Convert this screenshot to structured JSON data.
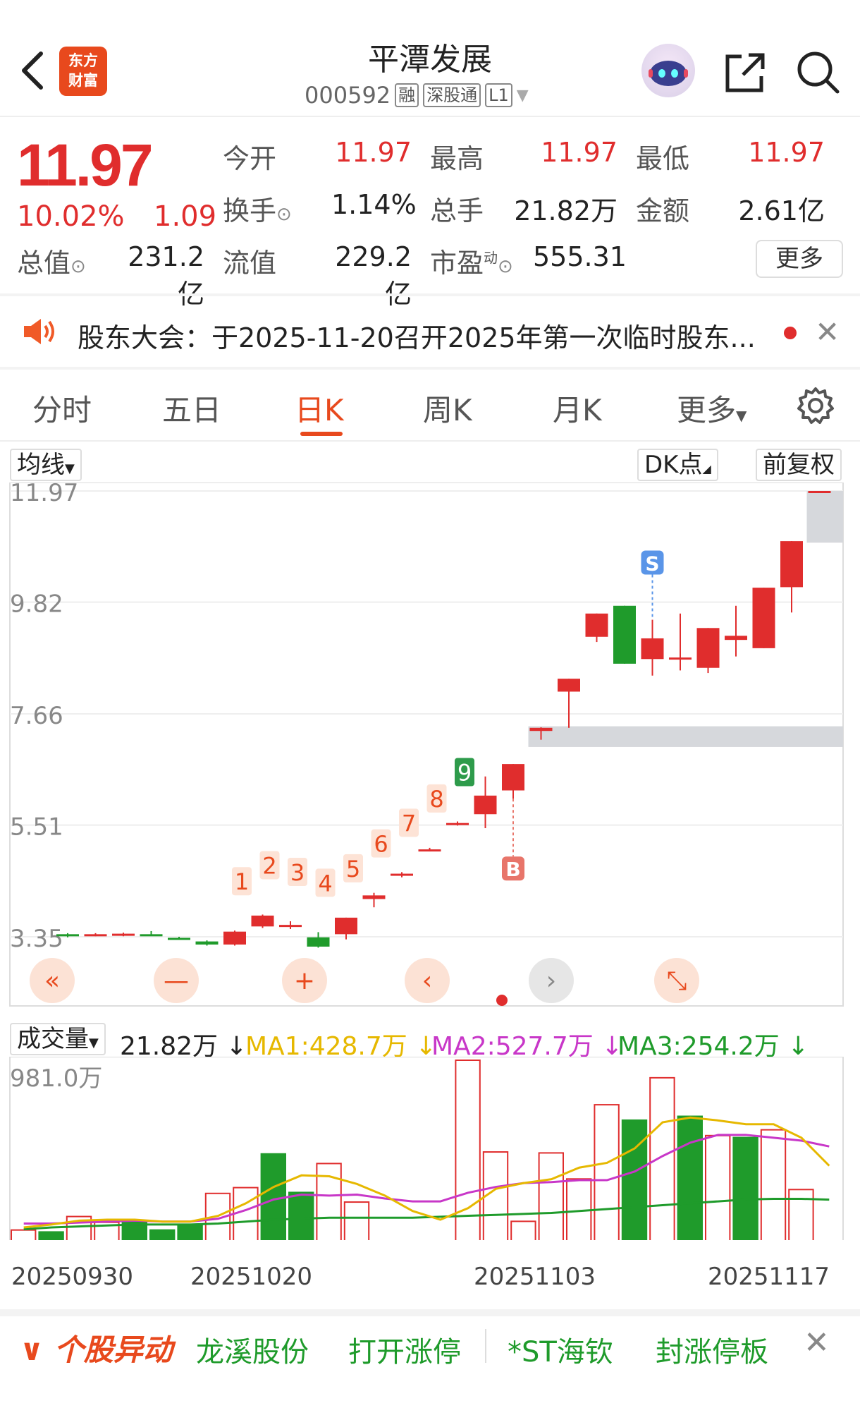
{
  "header": {
    "title": "平潭发展",
    "code": "000592",
    "tags": [
      "融",
      "深股通",
      "L1"
    ],
    "logo_text": "东方\n财富"
  },
  "quote": {
    "price": "11.97",
    "change_pct": "10.02%",
    "change": "1.09",
    "rows": [
      [
        {
          "label": "今开",
          "value": "11.97",
          "color": "red"
        },
        {
          "label": "最高",
          "value": "11.97",
          "color": "red"
        },
        {
          "label": "最低",
          "value": "11.97",
          "color": "red"
        }
      ],
      [
        {
          "label": "换手",
          "value": "1.14%",
          "color": "dark"
        },
        {
          "label": "总手",
          "value": "21.82万",
          "color": "dark"
        },
        {
          "label": "金额",
          "value": "2.61亿",
          "color": "dark"
        }
      ],
      [
        {
          "label": "总值",
          "value": "231.2亿",
          "color": "dark"
        },
        {
          "label": "流值",
          "value": "229.2亿",
          "color": "dark"
        },
        {
          "label": "市盈",
          "value": "555.31",
          "color": "dark"
        }
      ]
    ],
    "pe_superscript": "动",
    "more_label": "更多"
  },
  "notice": {
    "text": "股东大会：于2025-11-20召开2025年第一次临时股东..."
  },
  "tabs": {
    "items": [
      "分时",
      "五日",
      "日K",
      "周K",
      "月K",
      "更多"
    ],
    "active": "日K"
  },
  "toolbar": {
    "ma_label": "均线",
    "dk_label": "DK点",
    "adjust_label": "前复权"
  },
  "kline": {
    "y_labels": [
      "11.97",
      "9.82",
      "7.66",
      "5.51",
      "3.35"
    ],
    "ymin": 3.35,
    "ymax": 11.97,
    "candles": [
      {
        "o": 3.4,
        "c": 3.36,
        "h": 3.42,
        "l": 3.34
      },
      {
        "o": 3.38,
        "c": 3.4,
        "h": 3.42,
        "l": 3.36
      },
      {
        "o": 3.37,
        "c": 3.41,
        "h": 3.43,
        "l": 3.36
      },
      {
        "o": 3.4,
        "c": 3.38,
        "h": 3.46,
        "l": 3.37
      },
      {
        "o": 3.33,
        "c": 3.32,
        "h": 3.35,
        "l": 3.31
      },
      {
        "o": 3.26,
        "c": 3.2,
        "h": 3.28,
        "l": 3.18
      },
      {
        "o": 3.2,
        "c": 3.45,
        "h": 3.47,
        "l": 3.18
      },
      {
        "o": 3.55,
        "c": 3.76,
        "h": 3.78,
        "l": 3.52
      },
      {
        "o": 3.58,
        "c": 3.58,
        "h": 3.65,
        "l": 3.5
      },
      {
        "o": 3.34,
        "c": 3.16,
        "h": 3.44,
        "l": 3.14
      },
      {
        "o": 3.4,
        "c": 3.72,
        "h": 3.72,
        "l": 3.3
      },
      {
        "o": 4.08,
        "c": 4.15,
        "h": 4.2,
        "l": 3.92
      },
      {
        "o": 4.57,
        "c": 4.57,
        "h": 4.6,
        "l": 4.5
      },
      {
        "o": 5.04,
        "c": 5.04,
        "h": 5.07,
        "l": 5.0
      },
      {
        "o": 5.55,
        "c": 5.55,
        "h": 5.58,
        "l": 5.5
      },
      {
        "o": 5.72,
        "c": 6.08,
        "h": 6.45,
        "l": 5.45
      },
      {
        "o": 6.18,
        "c": 6.69,
        "h": 6.69,
        "l": 6.02
      },
      {
        "o": 7.33,
        "c": 7.39,
        "h": 7.4,
        "l": 7.16
      },
      {
        "o": 8.09,
        "c": 8.34,
        "h": 8.34,
        "l": 7.39
      },
      {
        "o": 9.15,
        "c": 9.6,
        "h": 9.6,
        "l": 9.05
      },
      {
        "o": 9.75,
        "c": 8.63,
        "h": 9.75,
        "l": 8.63
      },
      {
        "o": 8.72,
        "c": 9.12,
        "h": 9.48,
        "l": 8.4
      },
      {
        "o": 8.75,
        "c": 8.75,
        "h": 9.6,
        "l": 8.5
      },
      {
        "o": 8.55,
        "c": 9.32,
        "h": 9.32,
        "l": 8.45
      },
      {
        "o": 9.09,
        "c": 9.17,
        "h": 9.75,
        "l": 8.77
      },
      {
        "o": 8.93,
        "c": 10.1,
        "h": 10.1,
        "l": 8.93
      },
      {
        "o": 10.11,
        "c": 11.0,
        "h": 11.0,
        "l": 9.62
      },
      {
        "o": 11.97,
        "c": 11.97,
        "h": 11.97,
        "l": 11.97
      }
    ],
    "count_labels": [
      "1",
      "2",
      "3",
      "4",
      "5",
      "6",
      "7",
      "8",
      "9"
    ],
    "count_start_index": 7,
    "sell_marker": "S",
    "buy_marker": "B",
    "sell_index": 21,
    "buy_index": 16,
    "gaps": [
      {
        "from": 10.97,
        "to": 11.97,
        "start_index": 27
      },
      {
        "from": 7.02,
        "to": 7.42,
        "start_index": 17
      }
    ]
  },
  "volume": {
    "label": "成交量",
    "value": "21.82万",
    "ma1": "MA1:428.7万",
    "ma2": "MA2:527.7万",
    "ma3": "MA3:254.2万",
    "y_label": "981.0万",
    "max": 981.0,
    "bars": [
      {
        "v": 100,
        "up": true
      },
      {
        "v": 90,
        "up": false
      },
      {
        "v": 170,
        "up": true
      },
      {
        "v": 140,
        "up": true
      },
      {
        "v": 140,
        "up": false
      },
      {
        "v": 100,
        "up": false
      },
      {
        "v": 125,
        "up": false
      },
      {
        "v": 290,
        "up": true
      },
      {
        "v": 320,
        "up": true
      },
      {
        "v": 495,
        "up": false
      },
      {
        "v": 295,
        "up": false
      },
      {
        "v": 445,
        "up": true
      },
      {
        "v": 245,
        "up": true
      },
      {
        "v": 40,
        "up": true
      },
      {
        "v": 10,
        "up": true
      },
      {
        "v": 20,
        "up": true
      },
      {
        "v": 981,
        "up": true
      },
      {
        "v": 505,
        "up": true
      },
      {
        "v": 145,
        "up": true
      },
      {
        "v": 500,
        "up": true
      },
      {
        "v": 365,
        "up": true
      },
      {
        "v": 750,
        "up": true
      },
      {
        "v": 670,
        "up": false
      },
      {
        "v": 890,
        "up": true
      },
      {
        "v": 690,
        "up": false
      },
      {
        "v": 590,
        "up": true
      },
      {
        "v": 580,
        "up": false
      },
      {
        "v": 620,
        "up": true
      },
      {
        "v": 310,
        "up": true
      },
      {
        "v": 20,
        "up": true
      }
    ],
    "ma1_line": [
      110,
      125,
      145,
      150,
      150,
      140,
      140,
      170,
      235,
      320,
      380,
      375,
      335,
      275,
      195,
      150,
      210,
      310,
      340,
      360,
      420,
      445,
      520,
      655,
      680,
      665,
      645,
      645,
      575,
      430
    ],
    "ma2_line": [
      130,
      130,
      135,
      140,
      145,
      140,
      140,
      155,
      200,
      255,
      280,
      275,
      280,
      260,
      245,
      245,
      290,
      320,
      340,
      345,
      355,
      355,
      400,
      480,
      550,
      590,
      590,
      575,
      560,
      530
    ],
    "ma3_line": [
      100,
      110,
      115,
      120,
      125,
      125,
      125,
      130,
      140,
      150,
      155,
      160,
      160,
      160,
      160,
      165,
      170,
      175,
      180,
      185,
      195,
      205,
      215,
      225,
      235,
      245,
      255,
      258,
      258,
      254
    ]
  },
  "dates": [
    "20250930",
    "20251020",
    "20251103",
    "20251117"
  ],
  "ticker": {
    "brand": "个股异动",
    "items": [
      "龙溪股份",
      "打开涨停",
      "*ST海钦",
      "封涨停板"
    ]
  },
  "colors": {
    "red": "#e02d2d",
    "green": "#1f9b2b",
    "orange": "#e8491d",
    "ma1": "#e6b800",
    "ma2": "#c837c8",
    "ma3": "#1f9b2b"
  }
}
